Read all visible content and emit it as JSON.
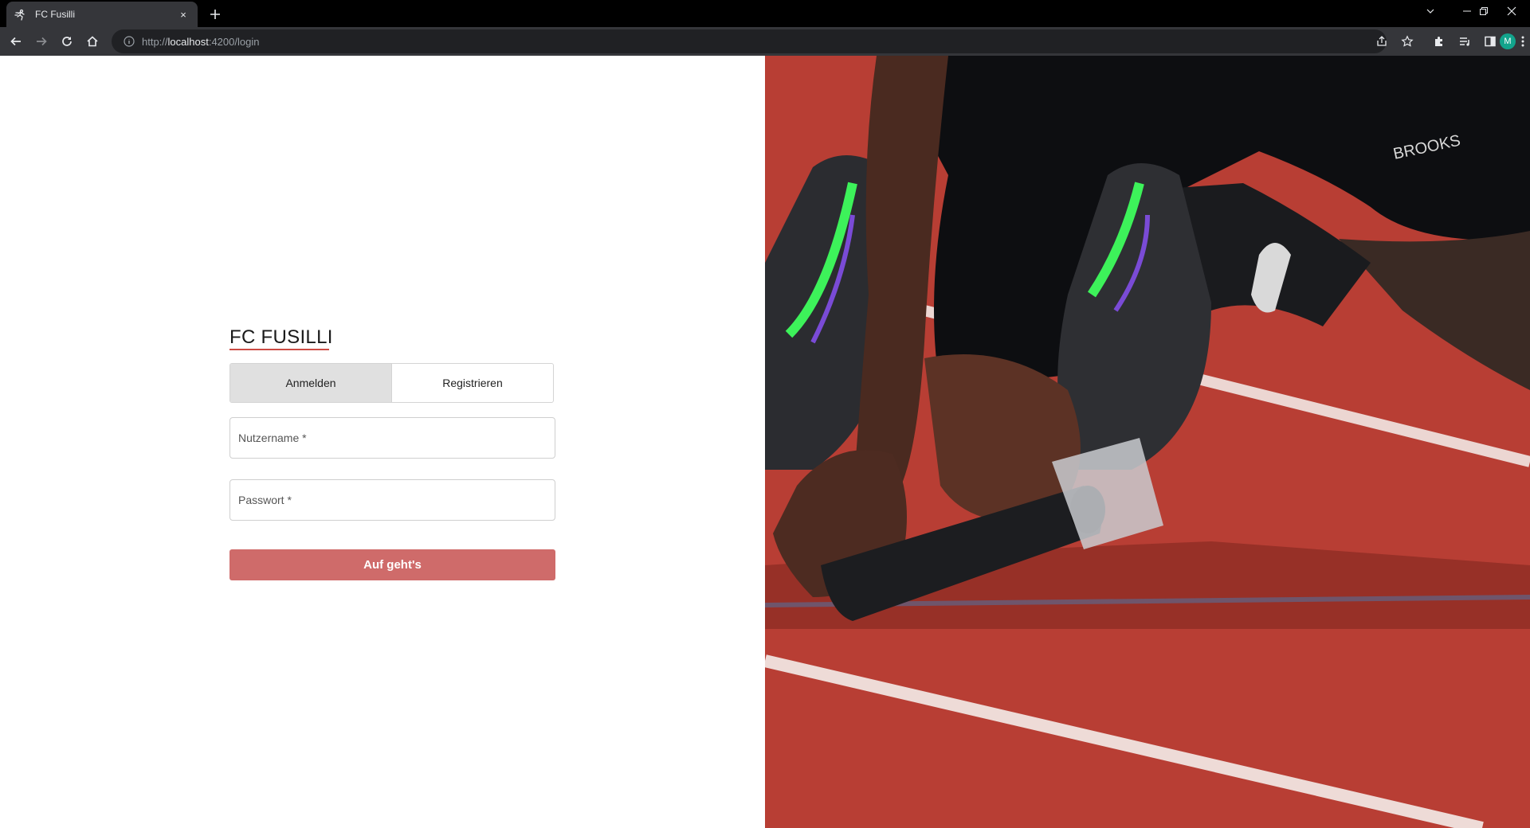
{
  "browser": {
    "tab_title": "FC Fusilli",
    "tab_close": "×",
    "new_tab": "+",
    "url_scheme": "http://",
    "url_host": "localhost",
    "url_rest": ":4200/login",
    "profile_initial": "M"
  },
  "login": {
    "brand": "FC FUSILLI",
    "tabs": [
      "Anmelden",
      "Registrieren"
    ],
    "username_placeholder": "Nutzername *",
    "password_placeholder": "Passwort *",
    "submit_label": "Auf geht's"
  },
  "colors": {
    "accent": "#cc4b44",
    "button": "#cf6b6a",
    "track": "#b5382f"
  },
  "hero_image": {
    "shoe_brand": "BROOKS"
  }
}
